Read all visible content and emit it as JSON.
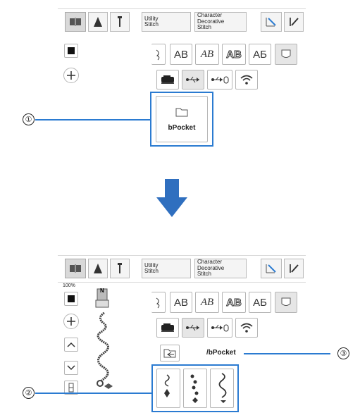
{
  "top_panel": {
    "utility_label": "Utility\nStitch",
    "character_label": "Character\nDecorative\nStitch",
    "font_buttons": [
      "AB",
      "AB",
      "AB",
      "AБ"
    ],
    "pocket_button": {
      "label": "bPocket"
    }
  },
  "bottom_panel": {
    "utility_label": "Utility\nStitch",
    "character_label": "Character\nDecorative\nStitch",
    "zoom": "100%",
    "presser_foot_label": "N",
    "font_buttons": [
      "AB",
      "AB",
      "AB",
      "AБ"
    ],
    "path": "/bPocket"
  },
  "callouts": {
    "one": "①",
    "two": "②",
    "three": "③"
  },
  "colors": {
    "accent": "#2b7bd1",
    "arrow": "#2f6fbf"
  }
}
